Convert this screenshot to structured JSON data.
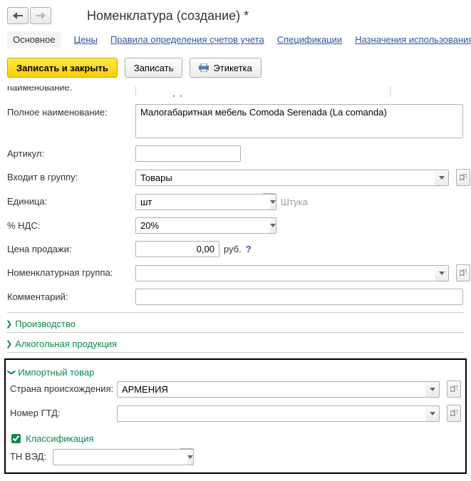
{
  "header": {
    "title": "Номенклатура (создание) *"
  },
  "tabs": {
    "main": "Основное",
    "prices": "Цены",
    "accounts": "Правила определения счетов учета",
    "specs": "Спецификации",
    "usage": "Назначения использования"
  },
  "toolbar": {
    "save_close": "Записать и закрыть",
    "save": "Записать",
    "label": "Этикетка"
  },
  "form": {
    "name_label_cut": "паименование.",
    "name_value_cut": "малогаоаритная меоель Comoda Serenada (La comanda)",
    "fullname_label": "Полное наименование:",
    "fullname_value": "Малогабаритная мебель Comoda Serenada (La comanda)",
    "sku_label": "Артикул:",
    "sku_value": "",
    "group_label": "Входит в группу:",
    "group_value": "Товары",
    "unit_label": "Единица:",
    "unit_value": "шт",
    "unit_hint": "Штука",
    "vat_label": "% НДС:",
    "vat_value": "20%",
    "price_label": "Цена продажи:",
    "price_value": "0,00",
    "price_cur": "руб.",
    "nomgroup_label": "Номенклатурная группа:",
    "nomgroup_value": "",
    "comment_label": "Комментарий:",
    "comment_value": ""
  },
  "sections": {
    "production": "Производство",
    "alcohol": "Алкогольная продукция",
    "import": "Импортный товар",
    "classification": "Классификация"
  },
  "import": {
    "country_label": "Страна происхождения:",
    "country_value": "АРМЕНИЯ",
    "gtd_label": "Номер ГТД:",
    "gtd_value": "",
    "tnved_label": "ТН ВЭД:",
    "tnved_value": ""
  }
}
